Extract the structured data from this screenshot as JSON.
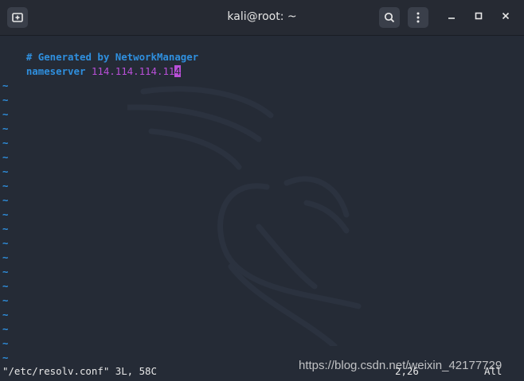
{
  "window": {
    "title": "kali@root: ~",
    "new_tab_icon": "new-tab-icon",
    "search_icon": "search-icon",
    "menu_icon": "kebab-menu-icon",
    "minimize_icon": "minimize-icon",
    "maximize_icon": "maximize-icon",
    "close_icon": "close-icon"
  },
  "editor": {
    "lines": [
      {
        "comment": "# Generated by NetworkManager"
      },
      {
        "keyword": "nameserver",
        "value": "114.114.114.11",
        "cursor_char": "4"
      }
    ],
    "tilde": "~",
    "tilde_count": 20
  },
  "statusbar": {
    "file_info": "\"/etc/resolv.conf\" 3L, 58C",
    "position": "2,26",
    "scroll": "All"
  },
  "watermark": "https://blog.csdn.net/weixin_42177729",
  "colors": {
    "background": "#252b36",
    "titlebar": "#262a33",
    "blue": "#2f8fde",
    "purple": "#b94fd8"
  }
}
